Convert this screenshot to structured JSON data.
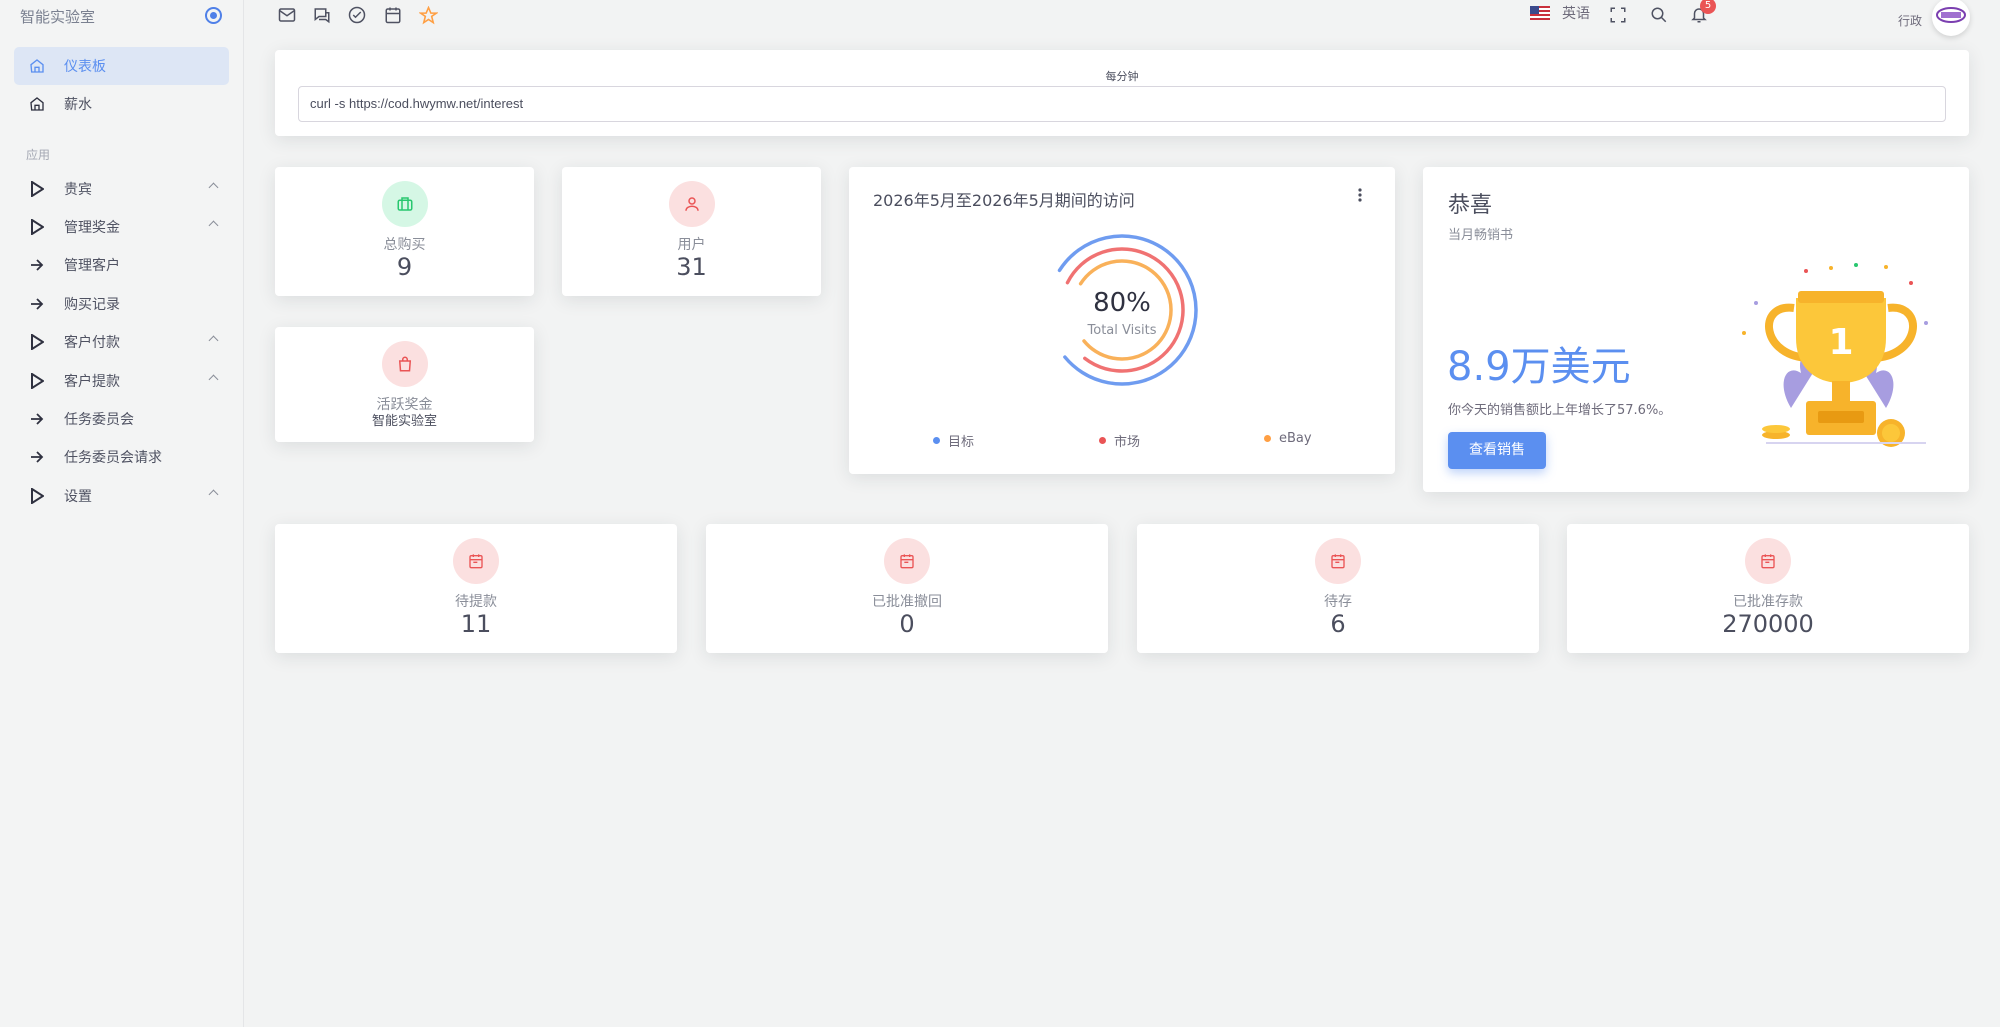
{
  "sidebar": {
    "brand": "智能实验室",
    "section_label": "应用",
    "items": [
      {
        "label": "仪表板",
        "icon": "home-icon",
        "active": true
      },
      {
        "label": "薪水",
        "icon": "home-icon"
      },
      {
        "label": "贵宾",
        "icon": "play-icon",
        "expandable": true
      },
      {
        "label": "管理奖金",
        "icon": "play-icon",
        "expandable": true
      },
      {
        "label": "管理客户",
        "icon": "arrow-right-icon"
      },
      {
        "label": "购买记录",
        "icon": "arrow-right-icon"
      },
      {
        "label": "客户付款",
        "icon": "play-icon",
        "expandable": true
      },
      {
        "label": "客户提款",
        "icon": "play-icon",
        "expandable": true
      },
      {
        "label": "任务委员会",
        "icon": "arrow-right-icon"
      },
      {
        "label": "任务委员会请求",
        "icon": "arrow-right-icon"
      },
      {
        "label": "设置",
        "icon": "play-icon",
        "expandable": true
      }
    ]
  },
  "topbar": {
    "icons": [
      "mail-icon",
      "chat-icon",
      "check-circle-icon",
      "calendar-icon",
      "star-icon"
    ],
    "language": "英语",
    "notification_count": "5",
    "username": "行政"
  },
  "command_card": {
    "label": "每分钟",
    "command": "curl -s https://cod.hwymw.net/interest"
  },
  "stats_top": [
    {
      "label": "总购买",
      "value": "9",
      "icon": "briefcase-icon"
    },
    {
      "label": "用户",
      "value": "31",
      "icon": "user-icon"
    },
    {
      "label": "活跃奖金",
      "value": "智能实验室",
      "icon": "shopping-bag-icon"
    }
  ],
  "visits_card": {
    "title": "2026年5月至2026年5月期间的访问",
    "center_value": "80%",
    "center_label": "Total Visits",
    "legend": [
      {
        "label": "目标",
        "color": "#5b8ff0"
      },
      {
        "label": "市场",
        "color": "#ea5455"
      },
      {
        "label": "eBay",
        "color": "#ff9f43"
      }
    ],
    "rings": [
      {
        "color": "#6f9cf0",
        "fraction": 0.8
      },
      {
        "color": "#f07272",
        "fraction": 0.78
      },
      {
        "color": "#f9b15a",
        "fraction": 0.8
      }
    ]
  },
  "congrats_card": {
    "title": "恭喜",
    "subtitle": "当月畅销书",
    "amount": "8.9万美元",
    "growth_text": "你今天的销售额比上年增长了57.6%。",
    "button_label": "查看销售",
    "trophy_number": "1"
  },
  "stats_bottom": [
    {
      "label": "待提款",
      "value": "11",
      "icon": "calendar-icon"
    },
    {
      "label": "已批准撤回",
      "value": "0",
      "icon": "calendar-icon"
    },
    {
      "label": "待存",
      "value": "6",
      "icon": "calendar-icon"
    },
    {
      "label": "已批准存款",
      "value": "270000",
      "icon": "calendar-icon"
    }
  ],
  "colors": {
    "accent": "#5b8ff0",
    "success_bg": "#d5f7e5",
    "success": "#28c76f",
    "danger_bg": "#fbe0e0",
    "danger": "#ea5455"
  }
}
